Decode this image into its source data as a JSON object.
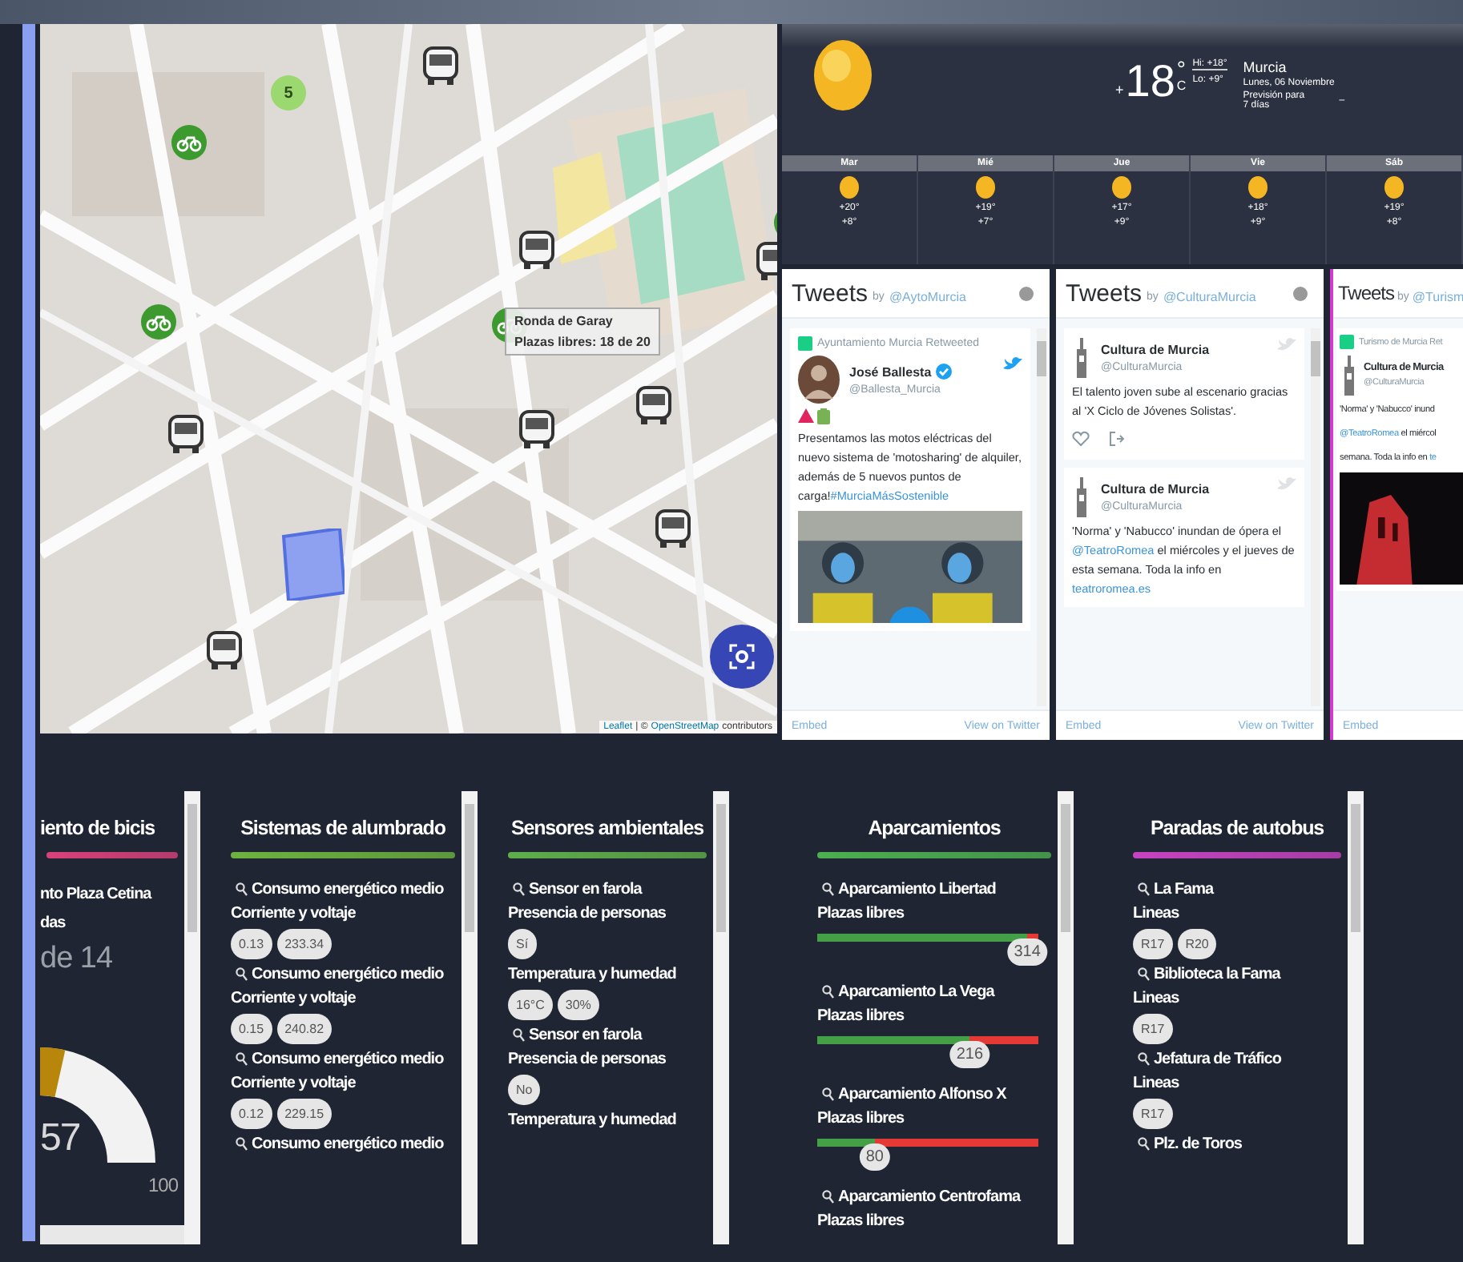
{
  "map": {
    "cluster": "5",
    "popup": {
      "title": "Ronda de Garay",
      "text": "Plazas libres: 18 de 20"
    },
    "attribution": [
      {
        "text": "Leaflet",
        "kind": "link"
      },
      {
        "text": "| ©",
        "kind": "text"
      },
      {
        "text": "OpenStreetMap",
        "kind": "link"
      },
      {
        "text": "contributors",
        "kind": "text"
      }
    ]
  },
  "weather": {
    "sign": "+",
    "temp": "18",
    "deg": "°",
    "unit": "C",
    "hi": "Hi: +18°",
    "lo": "Lo: +9°",
    "city": "Murcia",
    "date": "Lunes, 06 Noviembre",
    "forecast": "Previsión para 7 días",
    "toggle": "–",
    "days": [
      {
        "name": "Mar",
        "high": "+20°",
        "low": "+8°"
      },
      {
        "name": "Mié",
        "high": "+19°",
        "low": "+7°"
      },
      {
        "name": "Jue",
        "high": "+17°",
        "low": "+9°"
      },
      {
        "name": "Vie",
        "high": "+18°",
        "low": "+9°"
      },
      {
        "name": "Sáb",
        "high": "+19°",
        "low": "+8°"
      }
    ]
  },
  "tweet_columns": [
    {
      "title": "Tweets",
      "by": "by",
      "handle": "@AytoMurcia",
      "footer": [
        "Embed",
        "View on Twitter"
      ],
      "tweets": [
        {
          "retweet": "Ayuntamiento Murcia Retweeted",
          "avatar": {
            "kind": "person"
          },
          "name": "José Ballesta",
          "verified": true,
          "handle": "@Ballesta_Murcia",
          "bird_highlighted": true,
          "emoji": true,
          "parts": [
            {
              "text": "Presentamos las motos eléctricas del nuevo sistema de 'motosharing' de alquiler, además de 5 nuevos puntos de carga!",
              "link": false
            },
            {
              "text": "#MurciaMásSostenible",
              "link": true
            }
          ],
          "media": {
            "kind": "picture"
          }
        }
      ]
    },
    {
      "title": "Tweets",
      "by": "by",
      "handle": "@CulturaMurcia",
      "footer": [
        "Embed",
        "View on Twitter"
      ],
      "tweets": [
        {
          "avatar": {
            "kind": "tower"
          },
          "name": "Cultura de Murcia",
          "verified": false,
          "handle": "@CulturaMurcia",
          "bird_highlighted": false,
          "emoji": false,
          "parts": [
            {
              "text": "El talento joven sube al escenario gracias al 'X Ciclo de Jóvenes Solistas'.",
              "link": false
            }
          ],
          "actions": true
        },
        {
          "avatar": {
            "kind": "tower"
          },
          "name": "Cultura de Murcia",
          "verified": false,
          "handle": "@CulturaMurcia",
          "bird_highlighted": false,
          "emoji": false,
          "parts": [
            {
              "text": "'Norma' y 'Nabucco' inundan de ópera el ",
              "link": false
            },
            {
              "text": "@TeatroRomea",
              "link": true
            },
            {
              "text": " el miércoles y el jueves de esta semana. Toda la info en ",
              "link": false
            },
            {
              "text": "teatroromea.es",
              "link": true
            }
          ]
        }
      ]
    },
    {
      "title": "Tweets",
      "by": "by",
      "handle": "@Turism",
      "footer": [
        "Embed"
      ],
      "tweets": [
        {
          "retweet": "Turismo de Murcia Ret",
          "avatar": {
            "kind": "tower"
          },
          "name": "Cultura de Murcia",
          "verified": false,
          "handle": "@CulturaMurcia",
          "emoji": false,
          "lines": [
            [
              {
                "text": "'Norma' y 'Nabucco' inund",
                "link": false
              }
            ],
            [
              {
                "text": "@TeatroRomea",
                "link": true
              },
              {
                "text": " el miércol",
                "link": false
              }
            ],
            [
              {
                "text": "semana. Toda la info en ",
                "link": false
              },
              {
                "text": "te",
                "link": true
              }
            ]
          ],
          "media": {
            "kind": "picture"
          }
        }
      ]
    }
  ],
  "panels": [
    {
      "kind": "gauge",
      "title": "iento de bicis",
      "color": "#d9417a",
      "lines": [
        "nto Plaza Cetina",
        "das"
      ],
      "value_text": "de 14",
      "gauge": {
        "level": 0.57,
        "value": "57",
        "max": "100"
      }
    },
    {
      "kind": "list",
      "title": "Sistemas de alumbrado",
      "color": "#6db33f",
      "items": [
        {
          "name": "Consumo energético medio",
          "measures": [
            {
              "label": "Corriente y voltaje",
              "kind": "chips",
              "values": [
                "0.13",
                "233.34"
              ]
            }
          ]
        },
        {
          "name": "Consumo energético medio",
          "measures": [
            {
              "label": "Corriente y voltaje",
              "kind": "chips",
              "values": [
                "0.15",
                "240.82"
              ]
            }
          ]
        },
        {
          "name": "Consumo energético medio",
          "measures": [
            {
              "label": "Corriente y voltaje",
              "kind": "chips",
              "values": [
                "0.12",
                "229.15"
              ]
            }
          ]
        },
        {
          "name": "Consumo energético medio"
        }
      ]
    },
    {
      "kind": "list",
      "title": "Sensores ambientales",
      "color": "#5fae4a",
      "items": [
        {
          "name": "Sensor en farola",
          "measures": [
            {
              "label": "Presencia de personas",
              "kind": "chips",
              "values": [
                "Sí"
              ]
            },
            {
              "label": "Temperatura y humedad",
              "kind": "chips",
              "values": [
                "16°C",
                "30%"
              ]
            }
          ]
        },
        {
          "name": "Sensor en farola",
          "measures": [
            {
              "label": "Presencia de personas",
              "kind": "chips",
              "values": [
                "No"
              ]
            },
            {
              "label": "Temperatura y humedad",
              "kind": "chips"
            }
          ]
        }
      ]
    },
    {
      "kind": "list",
      "title": "Aparcamientos",
      "color": "#4caf50",
      "items": [
        {
          "name": "Aparcamiento Libertad",
          "measures": [
            {
              "label": "Plazas libres",
              "kind": "bar",
              "level": 0.95,
              "value": "314"
            }
          ]
        },
        {
          "name": "Aparcamiento La Vega",
          "measures": [
            {
              "label": "Plazas libres",
              "kind": "bar",
              "level": 0.69,
              "value": "216"
            }
          ]
        },
        {
          "name": "Aparcamiento Alfonso X",
          "measures": [
            {
              "label": "Plazas libres",
              "kind": "bar",
              "level": 0.26,
              "value": "80"
            }
          ]
        },
        {
          "name": "Aparcamiento Centrofama",
          "measures": [
            {
              "label": "Plazas libres",
              "kind": "label"
            }
          ]
        }
      ]
    },
    {
      "kind": "list",
      "title": "Paradas de autobus",
      "color": "#c743c0",
      "items": [
        {
          "name": "La Fama",
          "measures": [
            {
              "label": "Lineas",
              "kind": "chips",
              "values": [
                "R17",
                "R20"
              ]
            }
          ]
        },
        {
          "name": "Biblioteca la Fama",
          "measures": [
            {
              "label": "Lineas",
              "kind": "chips",
              "values": [
                "R17"
              ]
            }
          ]
        },
        {
          "name": "Jefatura de Tráfico",
          "measures": [
            {
              "label": "Lineas",
              "kind": "chips",
              "values": [
                "R17"
              ]
            }
          ]
        },
        {
          "name": "Plz. de Toros"
        }
      ]
    }
  ]
}
